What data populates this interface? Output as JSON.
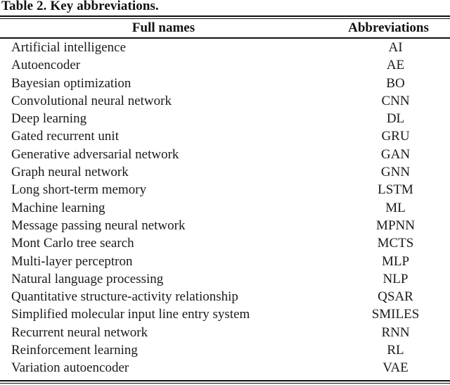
{
  "caption": "Table 2. Key abbreviations.",
  "table": {
    "headers": {
      "full_names": "Full names",
      "abbreviations": "Abbreviations"
    },
    "rows": [
      {
        "full": "Artificial intelligence",
        "abbr": "AI"
      },
      {
        "full": "Autoencoder",
        "abbr": "AE"
      },
      {
        "full": "Bayesian optimization",
        "abbr": "BO"
      },
      {
        "full": "Convolutional neural network",
        "abbr": "CNN"
      },
      {
        "full": "Deep learning",
        "abbr": "DL"
      },
      {
        "full": "Gated recurrent unit",
        "abbr": "GRU"
      },
      {
        "full": "Generative adversarial network",
        "abbr": "GAN"
      },
      {
        "full": "Graph neural network",
        "abbr": "GNN"
      },
      {
        "full": "Long short-term memory",
        "abbr": "LSTM"
      },
      {
        "full": "Machine learning",
        "abbr": "ML"
      },
      {
        "full": "Message passing neural network",
        "abbr": "MPNN"
      },
      {
        "full": "Mont Carlo tree search",
        "abbr": "MCTS"
      },
      {
        "full": "Multi-layer perceptron",
        "abbr": "MLP"
      },
      {
        "full": "Natural language processing",
        "abbr": "NLP"
      },
      {
        "full": "Quantitative structure-activity relationship",
        "abbr": "QSAR"
      },
      {
        "full": "Simplified molecular input line entry system",
        "abbr": "SMILES"
      },
      {
        "full": "Recurrent neural network",
        "abbr": "RNN"
      },
      {
        "full": "Reinforcement learning",
        "abbr": "RL"
      },
      {
        "full": "Variation autoencoder",
        "abbr": "VAE"
      }
    ]
  }
}
